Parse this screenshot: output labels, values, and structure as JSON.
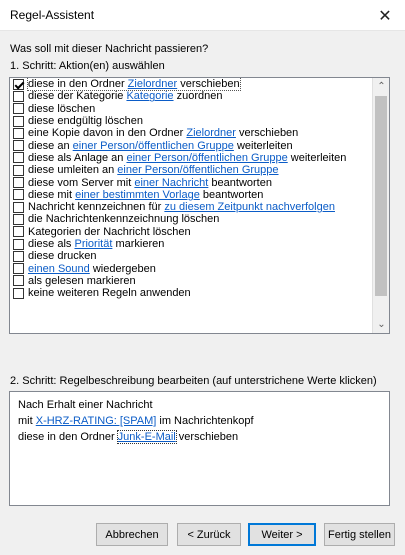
{
  "window": {
    "title": "Regel-Assistent",
    "close_glyph": "✕"
  },
  "question": "Was soll mit dieser Nachricht passieren?",
  "step1": {
    "label": "1. Schritt: Aktion(en) auswählen"
  },
  "actions": [
    {
      "checked": true,
      "before": "diese in den Ordner ",
      "link": "Zielordner",
      "after": " verschieben"
    },
    {
      "checked": false,
      "before": "diese der Kategorie ",
      "link": "Kategorie",
      "after": " zuordnen"
    },
    {
      "checked": false,
      "before": "diese löschen",
      "link": "",
      "after": ""
    },
    {
      "checked": false,
      "before": "diese endgültig löschen",
      "link": "",
      "after": ""
    },
    {
      "checked": false,
      "before": "eine Kopie davon in den Ordner ",
      "link": "Zielordner",
      "after": " verschieben"
    },
    {
      "checked": false,
      "before": "diese an ",
      "link": "einer Person/öffentlichen Gruppe",
      "after": " weiterleiten"
    },
    {
      "checked": false,
      "before": "diese als Anlage an ",
      "link": "einer Person/öffentlichen Gruppe",
      "after": " weiterleiten"
    },
    {
      "checked": false,
      "before": "diese umleiten an ",
      "link": "einer Person/öffentlichen Gruppe",
      "after": ""
    },
    {
      "checked": false,
      "before": "diese vom Server mit ",
      "link": "einer Nachricht",
      "after": " beantworten"
    },
    {
      "checked": false,
      "before": "diese mit ",
      "link": "einer bestimmten Vorlage",
      "after": " beantworten"
    },
    {
      "checked": false,
      "before": "Nachricht kennzeichnen für ",
      "link": "zu diesem Zeitpunkt nachverfolgen",
      "after": ""
    },
    {
      "checked": false,
      "before": "die Nachrichtenkennzeichnung löschen",
      "link": "",
      "after": ""
    },
    {
      "checked": false,
      "before": "Kategorien der Nachricht löschen",
      "link": "",
      "after": ""
    },
    {
      "checked": false,
      "before": "diese als ",
      "link": "Priorität",
      "after": " markieren"
    },
    {
      "checked": false,
      "before": "diese drucken",
      "link": "",
      "after": ""
    },
    {
      "checked": false,
      "before": "",
      "link": "einen Sound",
      "after": " wiedergeben"
    },
    {
      "checked": false,
      "before": "als gelesen markieren",
      "link": "",
      "after": ""
    },
    {
      "checked": false,
      "before": "keine weiteren Regeln anwenden",
      "link": "",
      "after": ""
    }
  ],
  "step2": {
    "label": "2. Schritt: Regelbeschreibung bearbeiten (auf unterstrichene Werte klicken)"
  },
  "description": {
    "line1": "Nach Erhalt einer Nachricht",
    "line2_before": "mit ",
    "line2_link": "X-HRZ-RATING: [SPAM]",
    "line2_after": " im Nachrichtenkopf",
    "line3_before": "diese in den Ordner ",
    "line3_link": "Junk-E-Mail",
    "line3_after": " verschieben"
  },
  "buttons": {
    "cancel": "Abbrechen",
    "back": "< Zurück",
    "next": "Weiter >",
    "finish": "Fertig stellen"
  },
  "scrollbar": {
    "up_glyph": "⌃",
    "down_glyph": "⌄"
  }
}
